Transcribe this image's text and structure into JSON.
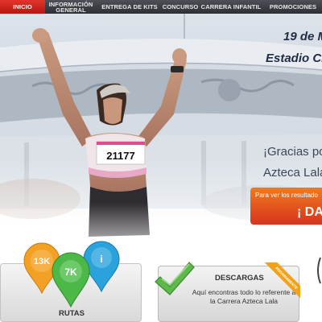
{
  "nav": {
    "items": [
      {
        "label": "INICIO",
        "active": true
      },
      {
        "label": "INFORMACIÓN GENERAL",
        "line1": "INFORMACIÓN",
        "line2": "GENERAL",
        "active": false
      },
      {
        "label": "ENTREGA DE KITS",
        "active": false
      },
      {
        "label": "CONCURSO",
        "active": false
      },
      {
        "label": "CARRERA INFANTIL",
        "active": false
      },
      {
        "label": "PROMOCIONES",
        "active": false
      }
    ]
  },
  "hero": {
    "date": "19 de M",
    "venue": "Estadio Ci",
    "thanks_line1": "¡Gracias po",
    "thanks_line2": "Azteca Lala",
    "bib_number": "21177",
    "results_label": "Para ver los resultado",
    "results_cta": "¡ DA C"
  },
  "routes": {
    "pins": [
      {
        "label": "13K",
        "color": "#f2a125",
        "icon": "13k-pin-icon"
      },
      {
        "label": "7K",
        "color": "#4cb848",
        "icon": "7k-pin-icon"
      },
      {
        "label": "i",
        "color": "#2aa3dc",
        "icon": "accessibility-pin-icon"
      }
    ],
    "title": "RUTAS"
  },
  "downloads": {
    "title": "DESCARGAS",
    "description": "Aquí encontras todo lo referente a la Carrera Azteca Lala",
    "ribbon": "PROXIMAMENTE",
    "icon": "download-arrow-icon"
  },
  "colors": {
    "nav_bg": "#3a3d42",
    "nav_active": "#d1241c",
    "heading": "#1f2c44",
    "cta_top": "#ef7b1f",
    "cta_bottom": "#d8331e"
  }
}
